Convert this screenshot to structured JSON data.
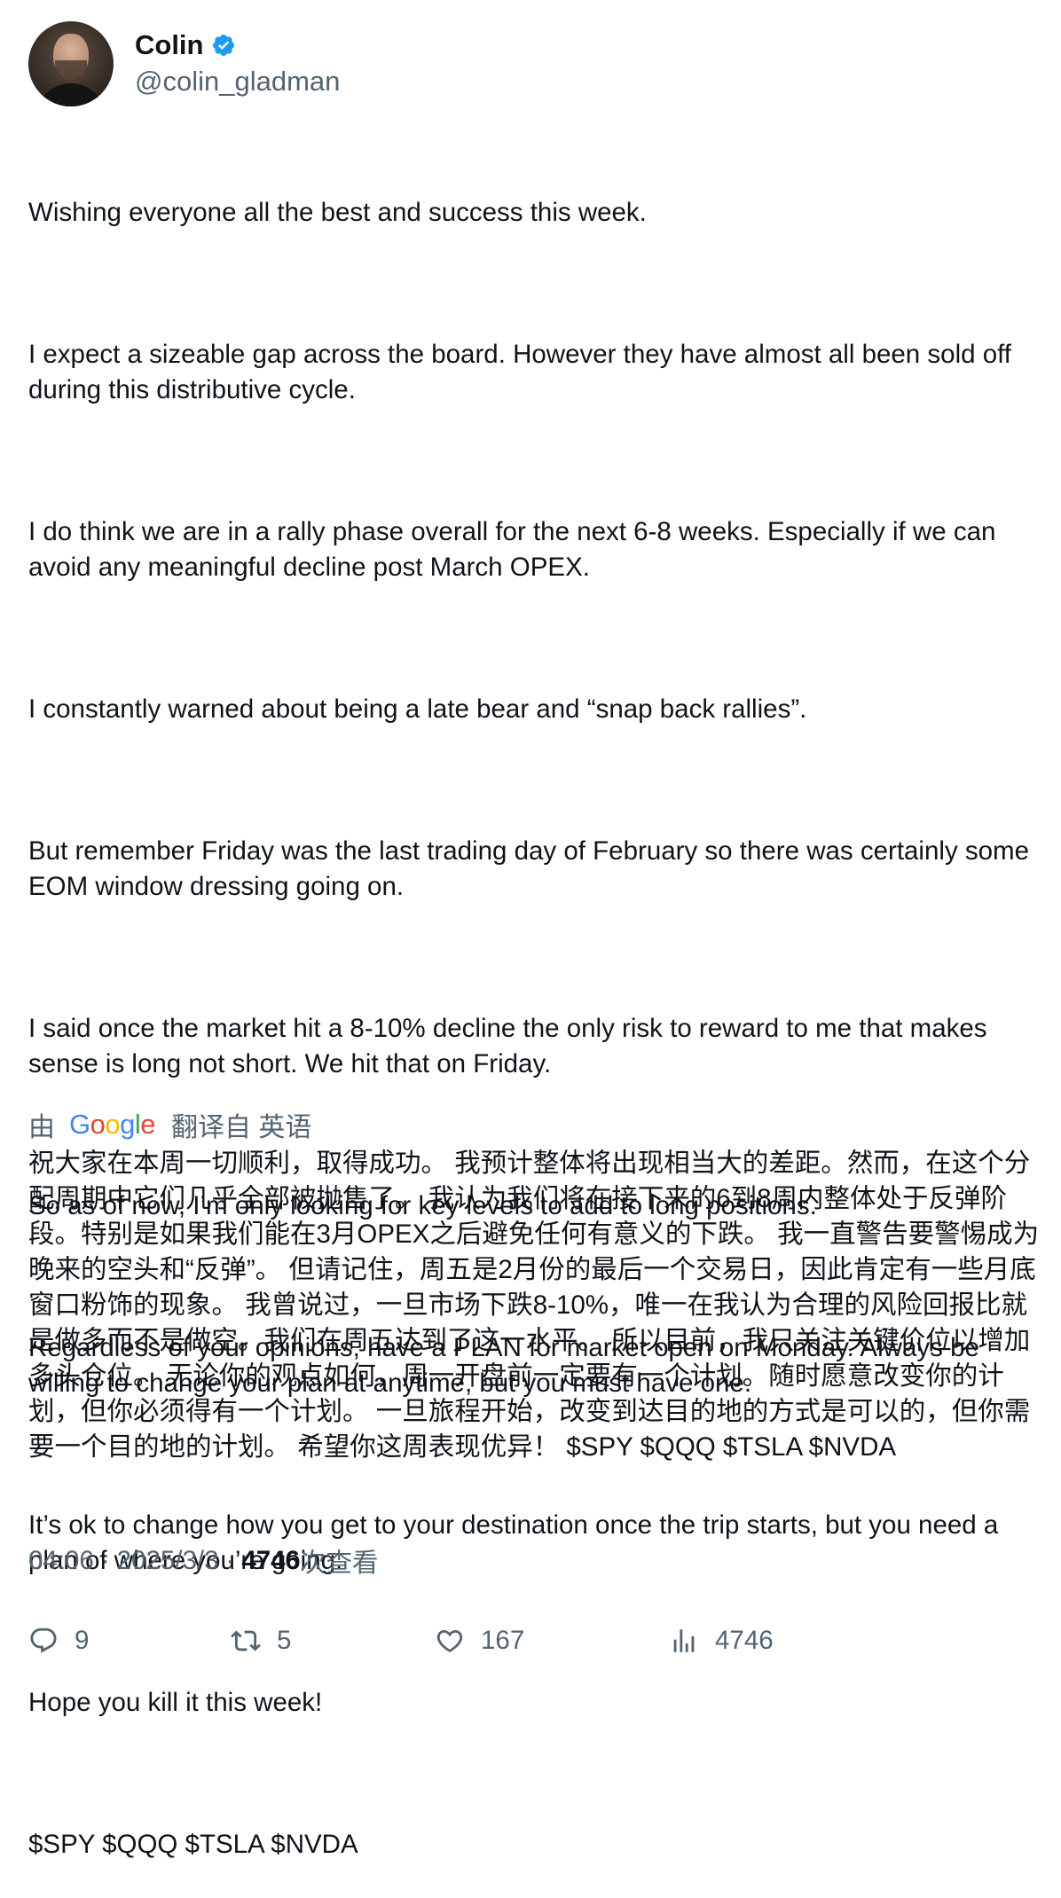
{
  "author": {
    "display_name": "Colin",
    "handle": "@colin_gladman",
    "verified": true
  },
  "tweet": {
    "paragraphs": [
      "Wishing everyone all the best and success this week.",
      "I expect a sizeable gap across the board. However they have almost all been sold off during this distributive cycle.",
      "I do think we are in a rally phase overall for the next 6-8 weeks. Especially if we can avoid any meaningful decline post March OPEX.",
      "I constantly warned about being a late bear and “snap back rallies”.",
      "But remember Friday was the last trading day of February so there was certainly some EOM window dressing going on.",
      "I said once the market hit a 8-10% decline the only risk to reward to me that makes sense is long not short. We hit that on Friday.",
      "So as of now, I’m only looking for key levels to add to long positions.",
      "Regardless of your opinions, have a PLAN for market open on Monday. Always be willing to change your plan at anytime, but you must have one.",
      "It’s ok to change how you get to your destination once the trip starts, but you need a plan of where you’re going.",
      "Hope you kill it this week!",
      "$SPY $QQQ $TSLA $NVDA"
    ]
  },
  "translation": {
    "by_label": "由",
    "provider": "Google",
    "from_label": "翻译自 英语",
    "text": "祝大家在本周一切顺利，取得成功。 我预计整体将出现相当大的差距。然而，在这个分配周期中它们几乎全部被抛售了。 我认为我们将在接下来的6到8周内整体处于反弹阶段。特别是如果我们能在3月OPEX之后避免任何有意义的下跌。 我一直警告要警惕成为晚来的空头和“反弹”。 但请记住，周五是2月份的最后一个交易日，因此肯定有一些月底窗口粉饰的现象。 我曾说过，一旦市场下跌8-10%，唯一在我认为合理的风险回报比就是做多而不是做空。我们在周五达到了这一水平。 所以目前，我只关注关键价位以增加多头仓位。 无论你的观点如何，周一开盘前一定要有一个计划。随时愿意改变你的计划，但你必须得有一个计划。 一旦旅程开始，改变到达目的地的方式是可以的，但你需要一个目的地的计划。 希望你这周表现优异！ $SPY $QQQ $TSLA $NVDA"
  },
  "meta": {
    "time": "04:06",
    "date": "2025/3/3",
    "separator": "·",
    "views_count": "4746",
    "views_label": "次查看"
  },
  "actions": {
    "replies": "9",
    "reposts": "5",
    "likes": "167",
    "views": "4746"
  },
  "colors": {
    "text": "#0f1419",
    "secondary": "#536471",
    "verified": "#1d9bf0"
  },
  "icons": [
    "verified-badge-icon",
    "reply-icon",
    "repost-icon",
    "like-icon",
    "views-icon",
    "google-logo"
  ]
}
